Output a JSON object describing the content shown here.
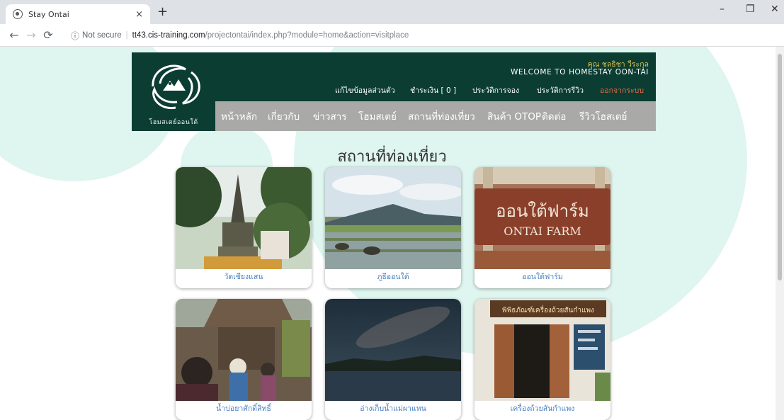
{
  "browser": {
    "tab_title": "Stay Ontai",
    "tab_close": "×",
    "new_tab": "+",
    "security_label": "Not secure",
    "url_host": "tt43.cis-training.com",
    "url_path": "/projectontai/index.php?module=home&action=visitplace",
    "win_minimize": "–",
    "win_restore": "❐",
    "win_close": "✕"
  },
  "site": {
    "logo_text": "โฮมสเตย์ออนใต้",
    "user_name": "คุณ ชลธิชา วีระกุล",
    "welcome": "WELCOME TO HOMESTAY OON-TAI",
    "account_links": [
      "แก้ไขข้อมูลส่วนตัว",
      "ชำระเงิน [ 0 ]",
      "ประวัติการจอง",
      "ประวัติการรีวิว",
      "ออกจากระบบ"
    ],
    "nav": [
      "หน้าหลัก",
      "เกี่ยวกับ",
      "ข่าวสาร",
      "โฮมสเตย์",
      "สถานที่ท่องเที่ยว",
      "สินค้า OTOP",
      "ติดต่อ",
      "รีวิวโฮสเตย์"
    ]
  },
  "page_title": "สถานที่ท่องเที่ยว",
  "places": [
    "วัดเชียงแสน",
    "ภูธีออนใต้",
    "ออนใต้ฟาร์ม",
    "น้ำบ่อยาศักดิ์สิทธิ์",
    "อ่างเก็บน้ำแม่ผาแหน",
    "เครื่องถ้วยสันกำแพง"
  ],
  "photo_texts": {
    "farm_sign_thai": "ออนใต้ฟาร์ม",
    "farm_sign_en": "ONTAI FARM",
    "museum_sign": "พิพิธภัณฑ์เครื่องถ้วยสันกำแพง"
  },
  "colors": {
    "header_green": "#0b3d33",
    "nav_gray": "#a9aaa8",
    "user_gold": "#e3c34a",
    "logout_red": "#e66b4a",
    "caption_blue": "#4a7fc0",
    "blob_mint": "#dff5ef"
  }
}
